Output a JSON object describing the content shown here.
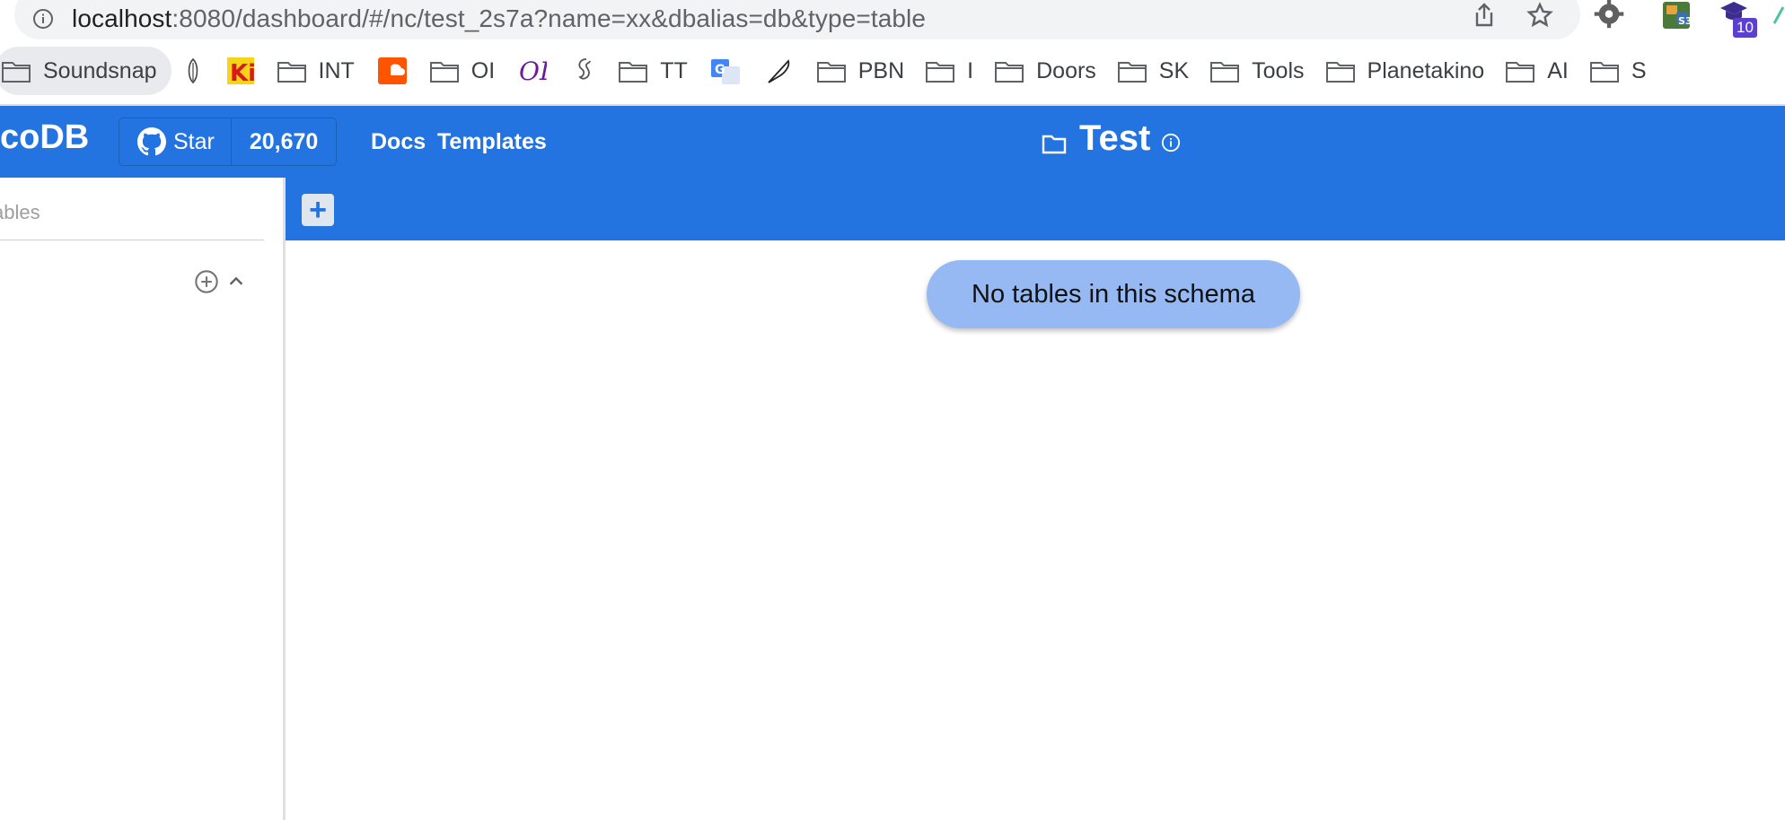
{
  "browser": {
    "url_host": "localhost",
    "url_rest": ":8080/dashboard/#/nc/test_2s7a?name=xx&dbalias=db&type=table",
    "extension_badge": "10",
    "bookmarks": [
      {
        "label": "Soundsnap",
        "icon": "folder-icon"
      },
      {
        "label": "",
        "icon": "feather-link-icon"
      },
      {
        "label": "",
        "icon": "ki-logo-icon"
      },
      {
        "label": "INT",
        "icon": "folder-icon"
      },
      {
        "label": "",
        "icon": "soundcloud-icon"
      },
      {
        "label": "OI",
        "icon": "folder-icon"
      },
      {
        "label": "",
        "icon": "oi-logo-icon"
      },
      {
        "label": "",
        "icon": "seahorse-icon"
      },
      {
        "label": "TT",
        "icon": "folder-icon"
      },
      {
        "label": "",
        "icon": "google-translate-icon"
      },
      {
        "label": "",
        "icon": "quill-icon"
      },
      {
        "label": "PBN",
        "icon": "folder-icon"
      },
      {
        "label": "I",
        "icon": "folder-icon"
      },
      {
        "label": "Doors",
        "icon": "folder-icon"
      },
      {
        "label": "SK",
        "icon": "folder-icon"
      },
      {
        "label": "Tools",
        "icon": "folder-icon"
      },
      {
        "label": "Planetakino",
        "icon": "folder-icon"
      },
      {
        "label": "AI",
        "icon": "folder-icon"
      },
      {
        "label": "S",
        "icon": "folder-icon"
      }
    ]
  },
  "header": {
    "logo": "coDB",
    "star_label": "Star",
    "star_count": "20,670",
    "docs_label": "Docs",
    "templates_label": "Templates",
    "project_title": "Test"
  },
  "sidebar": {
    "search_placeholder": "ables"
  },
  "tabs": {
    "add_label": "+"
  },
  "main": {
    "empty_message": "No tables in this schema"
  },
  "colors": {
    "brand": "#2374e1",
    "pill": "#96b9f3"
  }
}
